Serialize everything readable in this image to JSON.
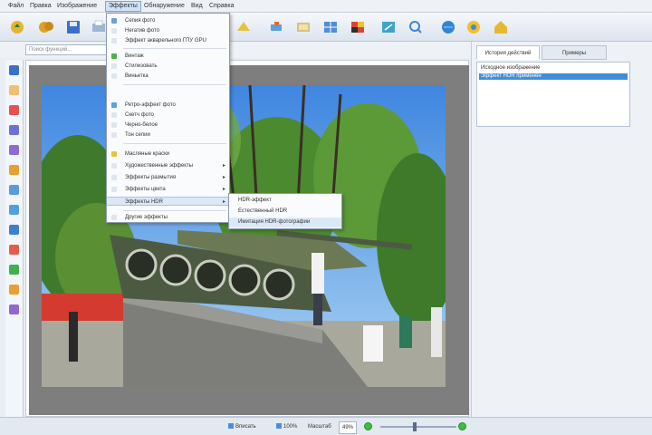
{
  "menubar": {
    "items": [
      "Файл",
      "Правка",
      "Изображение",
      "Эффекты",
      "Обнаружение",
      "Вид",
      "Справка"
    ],
    "active_index": 3
  },
  "search": {
    "placeholder": "Поиск функций..."
  },
  "effects_menu": {
    "items": [
      {
        "label": "Сепия фото",
        "icon": "sepia-icon",
        "icon_color": "#6aa0d8"
      },
      {
        "label": "Негатив фото",
        "icon": "negative-icon",
        "icon_color": "#e0e6ee"
      },
      {
        "label": "Эффект акварельного ГПУ GPU",
        "icon": "watercolor-icon",
        "icon_color": "#e0e6ee"
      },
      {
        "label": "Винтаж",
        "icon": "vintage-icon",
        "icon_color": "#4db04d"
      },
      {
        "label": "Стилизовать",
        "icon": "stylize-icon",
        "icon_color": "#e0e6ee"
      },
      {
        "label": "Виньетка",
        "icon": "vignette-icon",
        "icon_color": "#e0e6ee"
      },
      {
        "label": "Ретро-эффект фото",
        "icon": "retro-icon",
        "icon_color": "#5aa2e0"
      },
      {
        "label": "Скетч фото",
        "icon": "sketch-icon",
        "icon_color": "#e0e6ee"
      },
      {
        "label": "Черно-белое",
        "icon": "bw-icon",
        "icon_color": "#e0e6ee"
      },
      {
        "label": "Тон сепии",
        "icon": "sepia-tone-icon",
        "icon_color": "#e0e6ee"
      },
      {
        "label": "Масляные краски",
        "icon": "oil-paint-icon",
        "icon_color": "#e8c23a"
      },
      {
        "label": "Художественные эффекты",
        "icon": "art-icon",
        "icon_color": "#e0e6ee",
        "submenu": true
      },
      {
        "label": "Эффекты размытия",
        "icon": "blur-icon",
        "icon_color": "#e0e6ee",
        "submenu": true
      },
      {
        "label": "Эффекты цвета",
        "icon": "color-icon",
        "icon_color": "#e0e6ee",
        "submenu": true
      },
      {
        "label": "Эффекты HDR",
        "icon": "hdr-icon",
        "icon_color": "#e0e6ee",
        "submenu": true,
        "highlighted": true
      },
      {
        "label": "Другие эффекты",
        "icon": "other-icon",
        "icon_color": "#e0e6ee",
        "submenu": true
      }
    ]
  },
  "hdr_submenu": {
    "items": [
      "HDR-эффект",
      "Естественный HDR",
      "Имитация HDR-фотографии"
    ],
    "highlighted_index": 2
  },
  "right_panel": {
    "tabs": [
      "История действий",
      "Примеры"
    ],
    "active_tab": 0,
    "history": [
      "Исходное изображение",
      "Эффект HDR применен"
    ],
    "selected_index": 1
  },
  "statusbar": {
    "fit_label": "Вписать",
    "actual_label": "100%",
    "zoom_label": "Масштаб",
    "zoom_value": "49%",
    "zoom_fraction": 0.45
  },
  "colors": {
    "accent": "#3f8ed9",
    "status_green": "#3bbf3b"
  }
}
